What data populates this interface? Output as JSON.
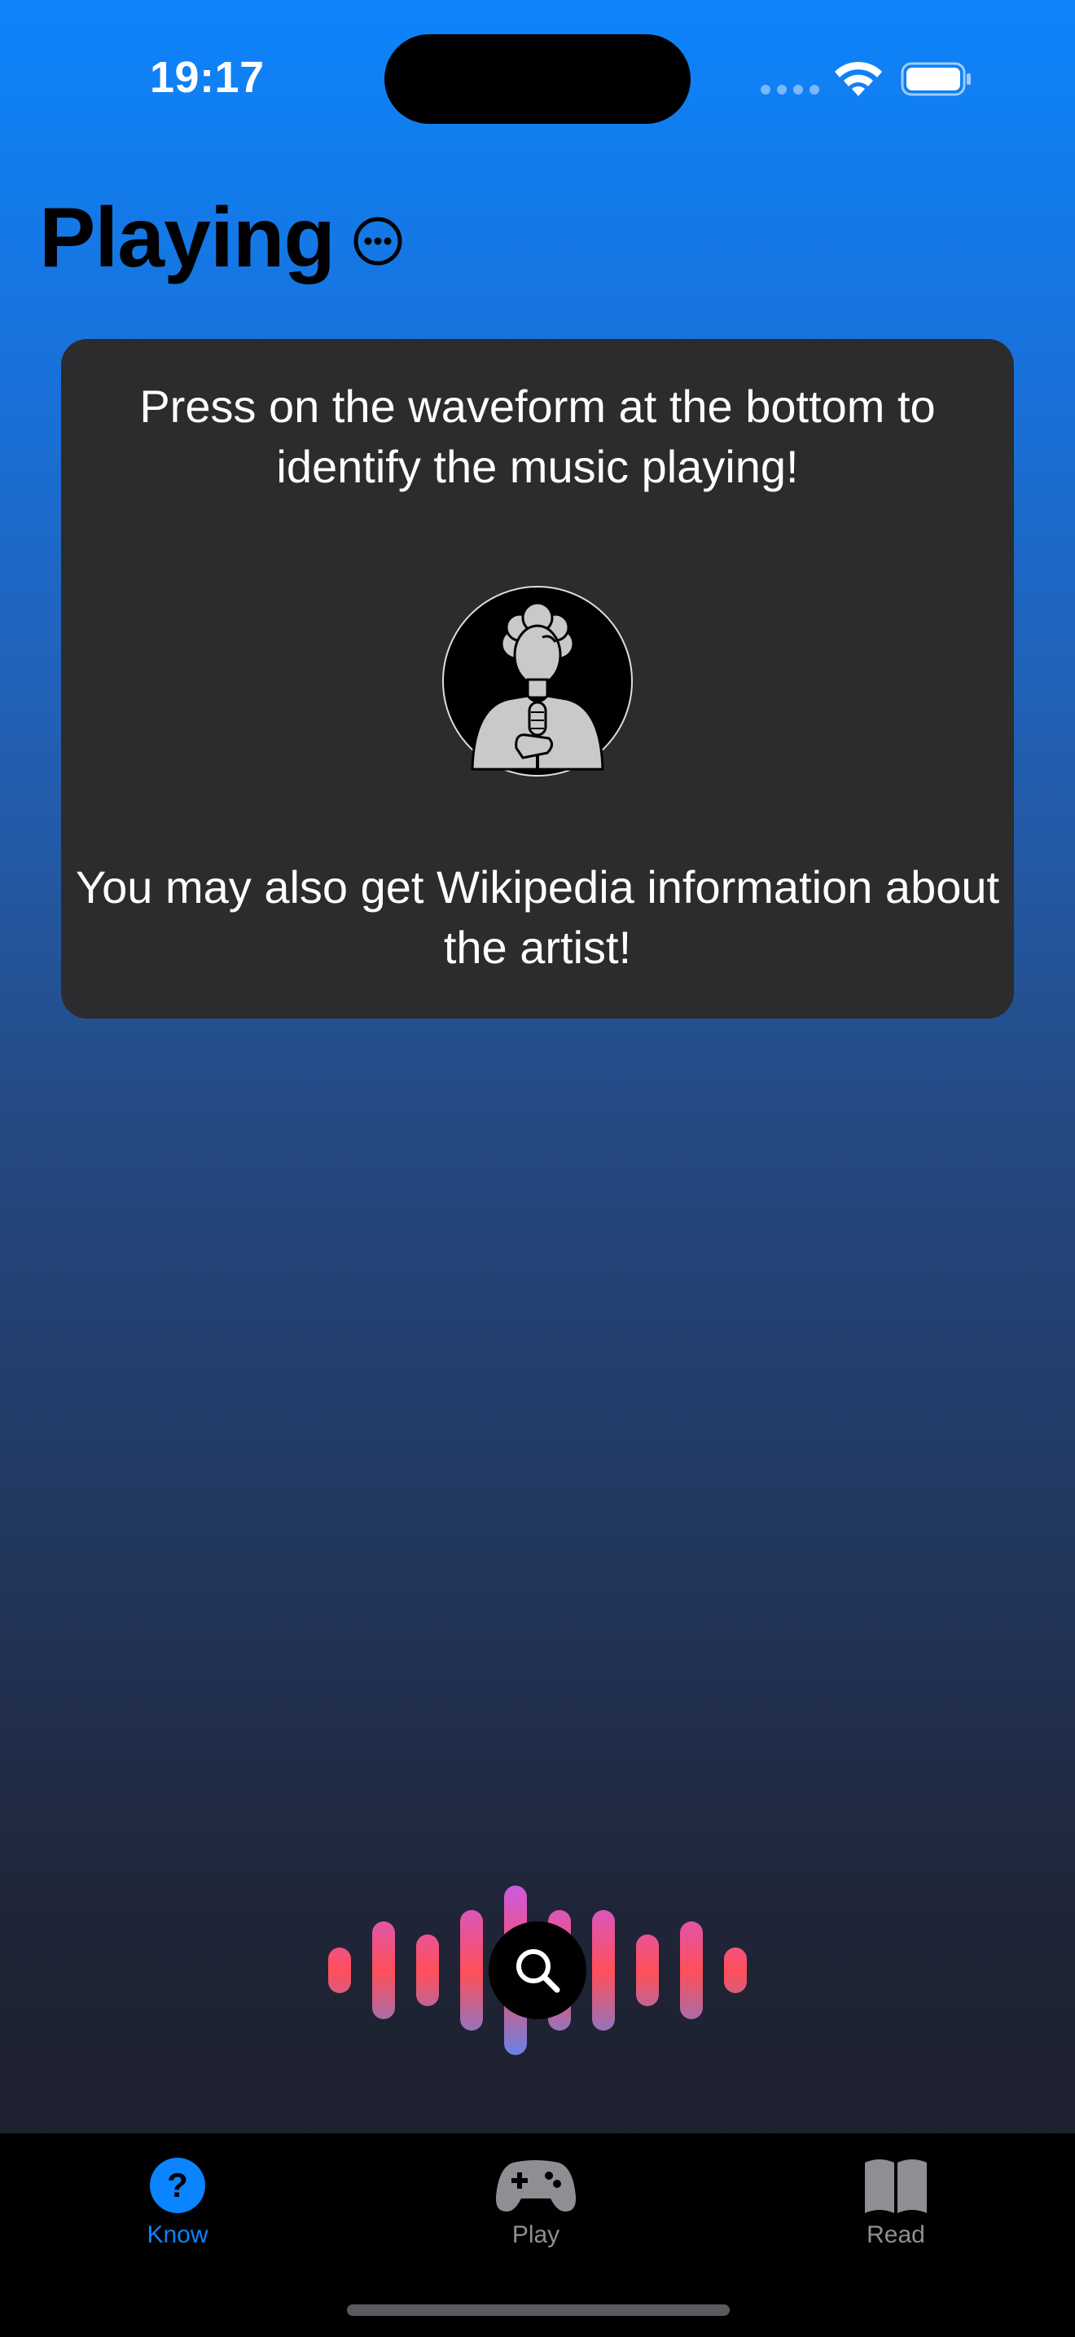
{
  "status_bar": {
    "time": "19:17"
  },
  "header": {
    "title": "Playing",
    "more_icon": "ellipsis-circle-icon"
  },
  "card": {
    "instruction_text": "Press on the waveform at the bottom to identify the music playing!",
    "avatar_icon": "singer-with-microphone-icon",
    "info_text": "You may also get Wikipedia information about the artist!"
  },
  "waveform": {
    "button_icon": "magnifying-glass-icon"
  },
  "tab_bar": {
    "tabs": [
      {
        "label": "Know",
        "icon": "question-circle-icon",
        "selected": true
      },
      {
        "label": "Play",
        "icon": "gamecontroller-icon",
        "selected": false
      },
      {
        "label": "Read",
        "icon": "book-icon",
        "selected": false
      }
    ]
  },
  "colors": {
    "accent": "#0a84ff",
    "card_background": "#2c2c2e",
    "tab_inactive": "#8e8e93",
    "wave_top": "#c55cf2",
    "wave_mid": "#ff4f59",
    "wave_bottom": "#4f8bff"
  }
}
